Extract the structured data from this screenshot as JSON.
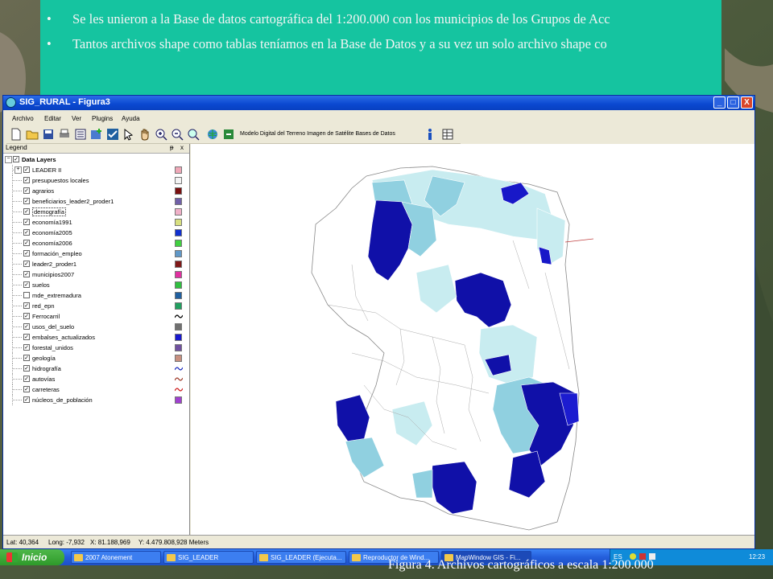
{
  "slide": {
    "bullets": [
      "Se les unieron a la Base de datos cartográfica  del 1:200.000 con los municipios de los Grupos de Acc",
      "Tantos archivos shape como tablas teníamos en la Base de Datos y  a su vez un solo archivo shape co"
    ],
    "bullet_symbol": "•",
    "caption": "Figura 4.  Archivos cartográficos  a escala 1:200.000"
  },
  "window": {
    "title": "SIG_RURAL  - Figura3",
    "controls": [
      "_",
      "□",
      "X"
    ],
    "menu": [
      "Archivo",
      "Editar",
      "Ver",
      "Plugins",
      "Ayuda"
    ],
    "toolbar_text": "Modelo Digital del Terreno  Imagen de Satélite  Bases de Datos"
  },
  "legend": {
    "title": "Legend",
    "controls": [
      "ᵽ",
      "x"
    ],
    "root": "Data Layers",
    "layers": [
      {
        "name": "LEADER II",
        "checked": true,
        "color": "#f0a8b8",
        "expander": true
      },
      {
        "name": "presupuestos locales",
        "checked": true,
        "color": "#f4f4f4"
      },
      {
        "name": "agrarios",
        "checked": true,
        "color": "#7a1010"
      },
      {
        "name": "beneficiarios_leader2_proder1",
        "checked": true,
        "color": "#7060a8"
      },
      {
        "name": "demografía",
        "checked": true,
        "color": "#f0b0c8",
        "selected": true
      },
      {
        "name": "economía1991",
        "checked": true,
        "color": "#d8e080"
      },
      {
        "name": "economía2005",
        "checked": true,
        "color": "#1030d0"
      },
      {
        "name": "economía2006",
        "checked": true,
        "color": "#40d040"
      },
      {
        "name": "formación_empleo",
        "checked": true,
        "color": "#6098c8"
      },
      {
        "name": "leader2_proder1",
        "checked": true,
        "color": "#801818"
      },
      {
        "name": "municipios2007",
        "checked": true,
        "color": "#e030a0"
      },
      {
        "name": "suelos",
        "checked": true,
        "color": "#30c040"
      },
      {
        "name": "mde_extremadura",
        "checked": false,
        "color": "#2060a0"
      },
      {
        "name": "red_epn",
        "checked": true,
        "color": "#20a060"
      },
      {
        "name": "Ferrocarril",
        "checked": true,
        "color": "line-black"
      },
      {
        "name": "usos_del_suelo",
        "checked": true,
        "color": "#707070"
      },
      {
        "name": "embalses_actualizados",
        "checked": true,
        "color": "#1818d0"
      },
      {
        "name": "forestal_unidos",
        "checked": true,
        "color": "#7050a0"
      },
      {
        "name": "geología",
        "checked": true,
        "color": "#c89080"
      },
      {
        "name": "hidrografía",
        "checked": true,
        "color": "line-blue"
      },
      {
        "name": "autovías",
        "checked": true,
        "color": "line-brown"
      },
      {
        "name": "carreteras",
        "checked": true,
        "color": "line-red"
      },
      {
        "name": "núcleos_de_población",
        "checked": true,
        "color": "#a040d0"
      }
    ]
  },
  "status": {
    "lat": "Lat: 40,364",
    "long": "Long: -7,932",
    "x": "X: 81.188,969",
    "y": "Y: 4.479.808,928 Meters"
  },
  "taskbar": {
    "start": "Inicio",
    "tasks": [
      {
        "label": "2007 Atonement",
        "active": false
      },
      {
        "label": "SIG_LEADER",
        "active": false
      },
      {
        "label": "SIG_LEADER (Ejecuta...",
        "active": false
      },
      {
        "label": "Reproductor de Wind...",
        "active": false
      },
      {
        "label": "MapWindow GIS - Fi...",
        "active": true
      }
    ],
    "lang": "ES",
    "time": "12:23"
  },
  "colors": {
    "accent_teal": "#15c4a0",
    "map_dark": "#1010a8",
    "map_mid": "#1c1cd0",
    "map_light": "#90d0e0",
    "map_pale": "#c8ecf0"
  }
}
